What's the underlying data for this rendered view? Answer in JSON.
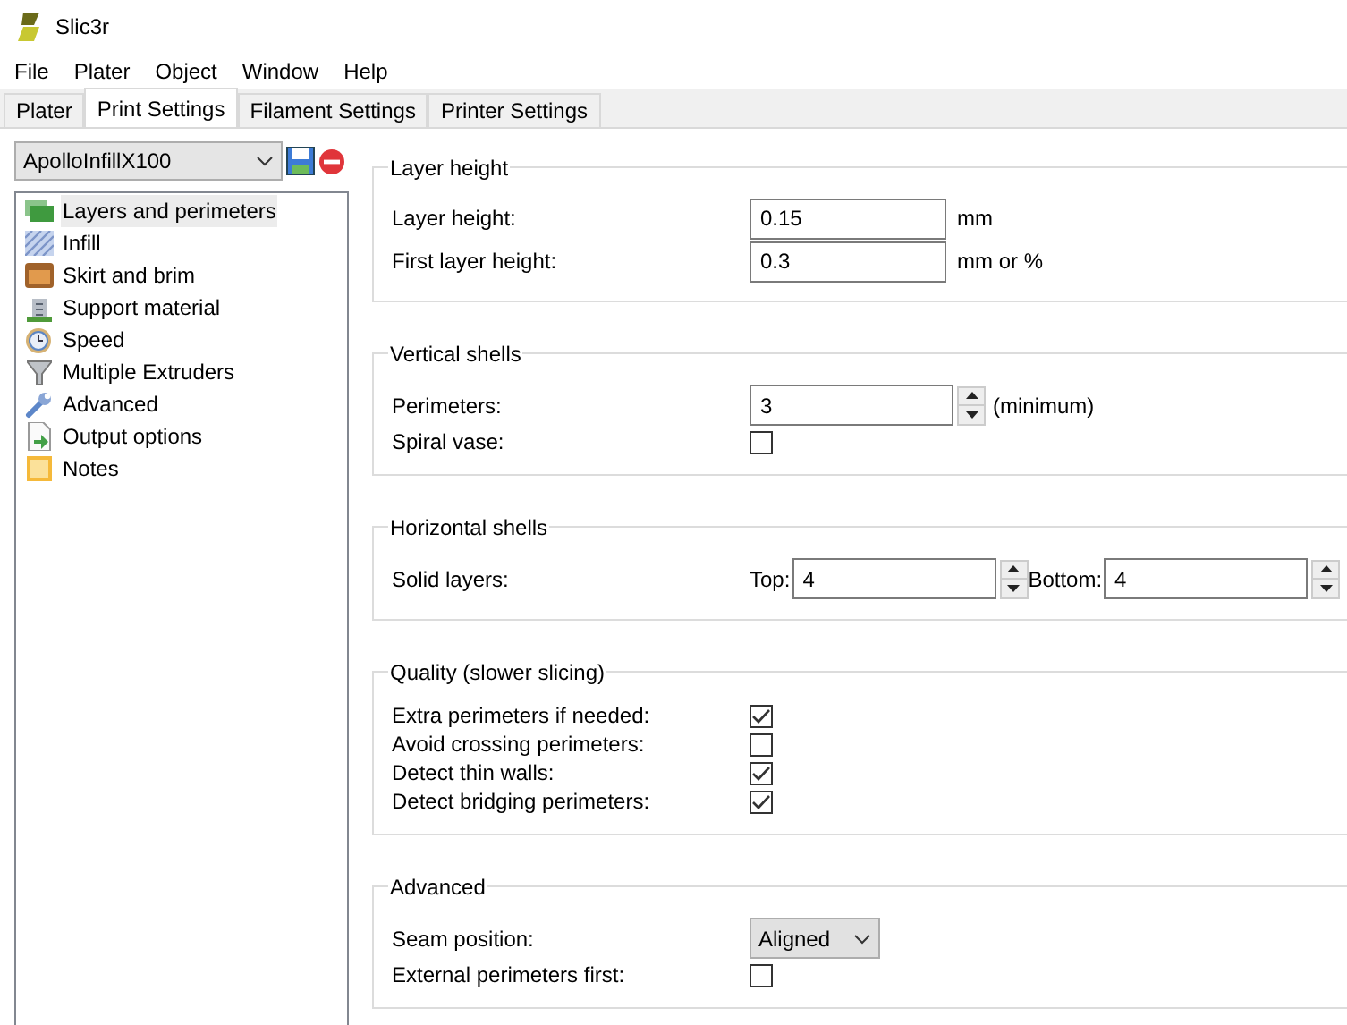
{
  "window": {
    "title": "Slic3r"
  },
  "menu": [
    "File",
    "Plater",
    "Object",
    "Window",
    "Help"
  ],
  "tabs": [
    {
      "label": "Plater",
      "selected": false
    },
    {
      "label": "Print Settings",
      "selected": true
    },
    {
      "label": "Filament Settings",
      "selected": false
    },
    {
      "label": "Printer Settings",
      "selected": false
    }
  ],
  "preset": {
    "value": "ApolloInfillX100"
  },
  "sidebar": {
    "items": [
      {
        "label": "Layers and perimeters",
        "selected": true
      },
      {
        "label": "Infill",
        "selected": false
      },
      {
        "label": "Skirt and brim",
        "selected": false
      },
      {
        "label": "Support material",
        "selected": false
      },
      {
        "label": "Speed",
        "selected": false
      },
      {
        "label": "Multiple Extruders",
        "selected": false
      },
      {
        "label": "Advanced",
        "selected": false
      },
      {
        "label": "Output options",
        "selected": false
      },
      {
        "label": "Notes",
        "selected": false
      }
    ]
  },
  "groups": [
    {
      "title": "Layer height",
      "rows": [
        {
          "kind": "text",
          "label": "Layer height:",
          "value": "0.15",
          "unit": "mm"
        },
        {
          "kind": "text",
          "label": "First layer height:",
          "value": "0.3",
          "unit": "mm or %"
        }
      ]
    },
    {
      "title": "Vertical shells",
      "rows": [
        {
          "kind": "spin",
          "label": "Perimeters:",
          "value": "3",
          "unit": "(minimum)"
        },
        {
          "kind": "check",
          "label": "Spiral vase:",
          "checked": false
        }
      ]
    },
    {
      "title": "Horizontal shells",
      "rows": [
        {
          "kind": "pair",
          "label": "Solid layers:",
          "fields": [
            {
              "label": "Top:",
              "value": "4"
            },
            {
              "label": "Bottom:",
              "value": "4"
            }
          ]
        }
      ]
    },
    {
      "title": "Quality (slower slicing)",
      "rows": [
        {
          "kind": "check",
          "label": "Extra perimeters if needed:",
          "checked": true
        },
        {
          "kind": "check",
          "label": "Avoid crossing perimeters:",
          "checked": false
        },
        {
          "kind": "check",
          "label": "Detect thin walls:",
          "checked": true
        },
        {
          "kind": "check",
          "label": "Detect bridging perimeters:",
          "checked": true
        }
      ]
    },
    {
      "title": "Advanced",
      "rows": [
        {
          "kind": "select",
          "label": "Seam position:",
          "value": "Aligned"
        },
        {
          "kind": "check",
          "label": "External perimeters first:",
          "checked": false
        }
      ]
    }
  ]
}
